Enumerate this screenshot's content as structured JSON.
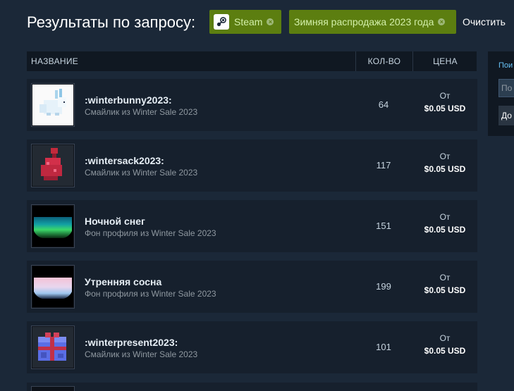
{
  "header": {
    "title": "Результаты по запросу:",
    "clear_label": "Очистить"
  },
  "filters": [
    {
      "label": "Steam",
      "icon": "steam-icon"
    },
    {
      "label": "Зимняя распродажа 2023 года"
    }
  ],
  "table": {
    "columns": {
      "name": "НАЗВАНИЕ",
      "quantity": "КОЛ-ВО",
      "price": "ЦЕНА"
    },
    "rows": [
      {
        "name": ":winterbunny2023:",
        "game": "Смайлик из Winter Sale 2023",
        "quantity": "64",
        "price_prefix": "От",
        "price": "$0.05 USD",
        "icon": "winter-bunny-emoticon"
      },
      {
        "name": ":wintersack2023:",
        "game": "Смайлик из Winter Sale 2023",
        "quantity": "117",
        "price_prefix": "От",
        "price": "$0.05 USD",
        "icon": "winter-sack-emoticon"
      },
      {
        "name": "Ночной снег",
        "game": "Фон профиля из Winter Sale 2023",
        "quantity": "151",
        "price_prefix": "От",
        "price": "$0.05 USD",
        "icon": "night-snow-background"
      },
      {
        "name": "Утренняя сосна",
        "game": "Фон профиля из Winter Sale 2023",
        "quantity": "199",
        "price_prefix": "От",
        "price": "$0.05 USD",
        "icon": "morning-pine-background"
      },
      {
        "name": ":winterpresent2023:",
        "game": "Смайлик из Winter Sale 2023",
        "quantity": "101",
        "price_prefix": "От",
        "price": "$0.05 USD",
        "icon": "winter-present-emoticon"
      }
    ]
  },
  "side_panel": {
    "label": "Пои",
    "input_placeholder": "По",
    "button_label": "До"
  },
  "colors": {
    "page_background": "#1b2838",
    "row_background": "#16202d",
    "filter_chip": "#5c7e10",
    "link": "#67c1f5"
  }
}
